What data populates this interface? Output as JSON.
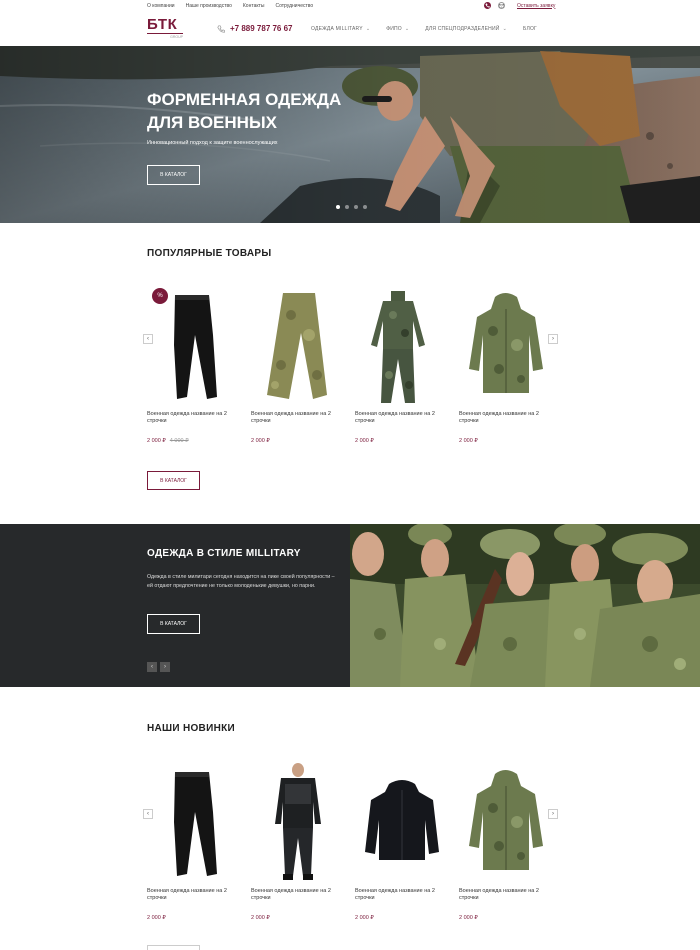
{
  "topbar": {
    "links": [
      "О компании",
      "Наше производство",
      "Контакты",
      "Сотрудничество"
    ],
    "request_link": "Оставить заявку"
  },
  "header": {
    "logo_main": "БТК",
    "logo_sub": "GROUP",
    "phone": "+7 889 787 76 67",
    "nav": [
      {
        "label": "ОДЕЖДА MILLITARY",
        "caret": "⌄"
      },
      {
        "label": "ФИПО",
        "caret": "⌄"
      },
      {
        "label": "ДЛЯ СПЕЦПОДРАЗДЕЛЕНИЙ",
        "caret": "⌄"
      },
      {
        "label": "БЛОГ",
        "caret": ""
      }
    ]
  },
  "hero": {
    "title": "ФОРМЕННАЯ ОДЕЖДА ДЛЯ ВОЕННЫХ",
    "subtitle": "Инновационный подход к защите военнослужащих",
    "button": "В КАТАЛОГ",
    "slide_index": 1,
    "slide_count": 4
  },
  "popular": {
    "title": "ПОПУЛЯРНЫЕ ТОВАРЫ",
    "badge": "%",
    "prev": "‹",
    "next": "›",
    "button": "В КАТАЛОГ",
    "items": [
      {
        "name": "Военная одежда название на 2 строчки",
        "price": "2 000 ₽",
        "old_price": "4 000 ₽",
        "image": "black-pants"
      },
      {
        "name": "Военная одежда название на 2 строчки",
        "price": "2 000 ₽",
        "old_price": "",
        "image": "camo-pants"
      },
      {
        "name": "Военная одежда название на 2 строчки",
        "price": "2 000 ₽",
        "old_price": "",
        "image": "camo-suit"
      },
      {
        "name": "Военная одежда название на 2 строчки",
        "price": "2 000 ₽",
        "old_price": "",
        "image": "camo-jacket"
      }
    ]
  },
  "military": {
    "title": "ОДЕЖДА В СТИЛЕ MILLITARY",
    "text": "Одежда в стиле милитари сегодня находится на пике своей популярности – ей отдают предпочтение не только молоденькие девушки, но парни.",
    "button": "В КАТАЛОГ",
    "prev": "‹",
    "next": "›"
  },
  "novelties": {
    "title": "НАШИ НОВИНКИ",
    "prev": "‹",
    "next": "›",
    "items": [
      {
        "name": "Военная одежда название на 2 строчки",
        "price": "2 000 ₽",
        "image": "black-pants"
      },
      {
        "name": "Военная одежда название на 2 строчки",
        "price": "2 000 ₽",
        "image": "black-suit"
      },
      {
        "name": "Военная одежда название на 2 строчки",
        "price": "2 000 ₽",
        "image": "black-jacket"
      },
      {
        "name": "Военная одежда название на 2 строчки",
        "price": "2 000 ₽",
        "image": "camo-jacket"
      }
    ]
  },
  "colors": {
    "accent": "#7a1a3a",
    "dark_block": "#27292b"
  }
}
